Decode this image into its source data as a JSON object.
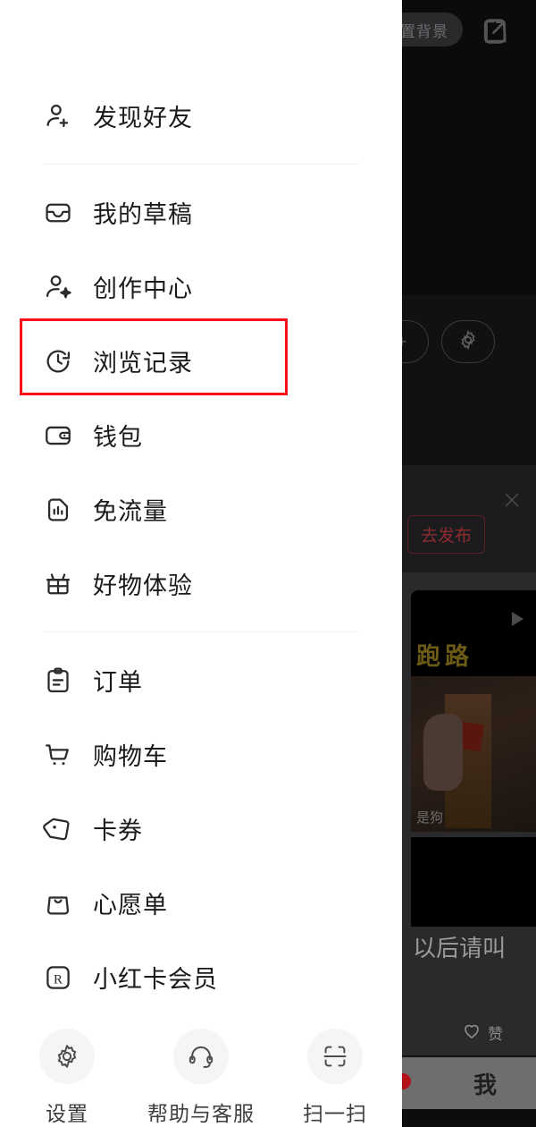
{
  "background": {
    "set_background_pill": "置背景",
    "share_icon": "external-link-icon",
    "gear_icon": "gear-icon",
    "plus_icon": "plus-icon",
    "close_icon": "close-icon",
    "publish_button": "去发布",
    "feed_video_title": "跑路",
    "feed_video_sub": "是狗",
    "feed_post_text": "以后请叫",
    "like_label": "赞",
    "like_icon": "heart-icon",
    "play_icon": "play-icon",
    "tab_me": "我"
  },
  "drawer": {
    "groups": [
      {
        "items": [
          {
            "label": "发现好友",
            "icon": "user-plus-icon",
            "highlighted": false
          }
        ]
      },
      {
        "items": [
          {
            "label": "我的草稿",
            "icon": "inbox-icon",
            "highlighted": false
          },
          {
            "label": "创作中心",
            "icon": "user-sparkle-icon",
            "highlighted": false
          },
          {
            "label": "浏览记录",
            "icon": "history-clock-icon",
            "highlighted": true
          },
          {
            "label": "钱包",
            "icon": "wallet-icon",
            "highlighted": false
          },
          {
            "label": "免流量",
            "icon": "sim-card-icon",
            "highlighted": false
          },
          {
            "label": "好物体验",
            "icon": "gift-icon",
            "highlighted": false
          }
        ]
      },
      {
        "items": [
          {
            "label": "订单",
            "icon": "clipboard-icon",
            "highlighted": false
          },
          {
            "label": "购物车",
            "icon": "shopping-cart-icon",
            "highlighted": false
          },
          {
            "label": "卡券",
            "icon": "coupon-tag-icon",
            "highlighted": false
          },
          {
            "label": "心愿单",
            "icon": "shopping-bag-icon",
            "highlighted": false
          },
          {
            "label": "小红卡会员",
            "icon": "red-card-r-icon",
            "highlighted": false
          }
        ]
      }
    ],
    "bottom_actions": [
      {
        "label": "设置",
        "icon": "gear-icon"
      },
      {
        "label": "帮助与客服",
        "icon": "headset-icon"
      },
      {
        "label": "扫一扫",
        "icon": "scan-icon"
      }
    ]
  },
  "colors": {
    "highlight_box": "#fc0d1b",
    "panel_bg": "#ffffff",
    "divider": "#f0f0f0",
    "text_primary": "#1a1a1a"
  }
}
